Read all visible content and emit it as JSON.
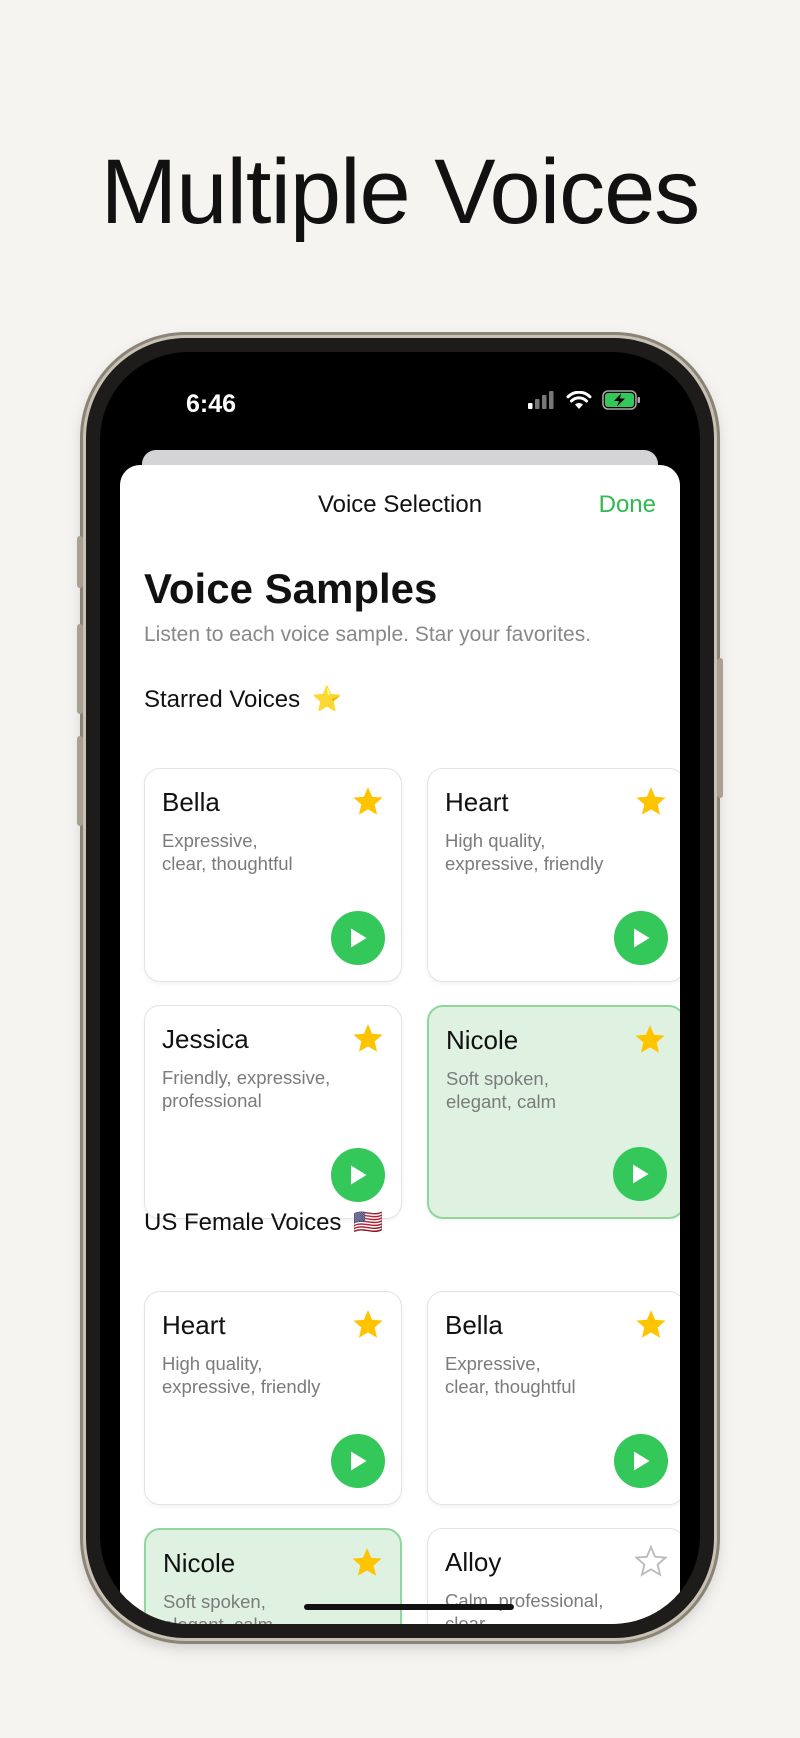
{
  "headline": "Multiple Voices",
  "status_bar": {
    "time": "6:46"
  },
  "nav": {
    "title": "Voice Selection",
    "done_label": "Done"
  },
  "page": {
    "title": "Voice Samples",
    "subtitle": "Listen to each voice sample. Star your favorites."
  },
  "sections": [
    {
      "title": "Starred Voices",
      "emoji": "⭐",
      "cards": [
        {
          "name": "Bella",
          "desc_line1": "Expressive,",
          "desc_line2": "clear, thoughtful",
          "starred": true,
          "selected": false
        },
        {
          "name": "Heart",
          "desc_line1": "High quality,",
          "desc_line2": "expressive, friendly",
          "starred": true,
          "selected": false
        },
        {
          "name": "Jessica",
          "desc_line1": "Friendly, expressive,",
          "desc_line2": "professional",
          "starred": true,
          "selected": false
        },
        {
          "name": "Nicole",
          "desc_line1": "Soft spoken,",
          "desc_line2": "elegant, calm",
          "starred": true,
          "selected": true
        }
      ]
    },
    {
      "title": "US Female Voices",
      "emoji": "🇺🇸",
      "cards": [
        {
          "name": "Heart",
          "desc_line1": "High quality,",
          "desc_line2": "expressive, friendly",
          "starred": true,
          "selected": false
        },
        {
          "name": "Bella",
          "desc_line1": "Expressive,",
          "desc_line2": "clear, thoughtful",
          "starred": true,
          "selected": false
        },
        {
          "name": "Nicole",
          "desc_line1": "Soft spoken,",
          "desc_line2": "elegant, calm",
          "starred": true,
          "selected": true
        },
        {
          "name": "Alloy",
          "desc_line1": "Calm, professional,",
          "desc_line2": "clear",
          "starred": false,
          "selected": false
        }
      ]
    }
  ],
  "colors": {
    "accent": "#34c75a",
    "done": "#2dbb4f",
    "star": "#ffc400",
    "selected_bg": "#dff1e1",
    "selected_border": "#8fd79c"
  },
  "icons": {
    "star": "star-icon",
    "play": "play-icon",
    "signal": "signal-icon",
    "wifi": "wifi-icon",
    "battery": "battery-charging-icon"
  }
}
